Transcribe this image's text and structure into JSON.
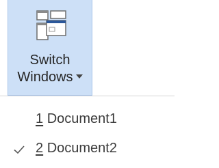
{
  "ribbon": {
    "switch_windows": {
      "label_line1": "Switch",
      "label_line2": "Windows",
      "icon": "switch-windows-icon"
    }
  },
  "menu": {
    "items": [
      {
        "number": "1",
        "title": "Document1",
        "checked": false
      },
      {
        "number": "2",
        "title": "Document2",
        "checked": true
      }
    ]
  },
  "colors": {
    "button_hover_bg": "#cde0f7",
    "button_hover_border": "#a7c4ea",
    "text": "#3b3b3b",
    "icon_accent": "#2b579a"
  }
}
